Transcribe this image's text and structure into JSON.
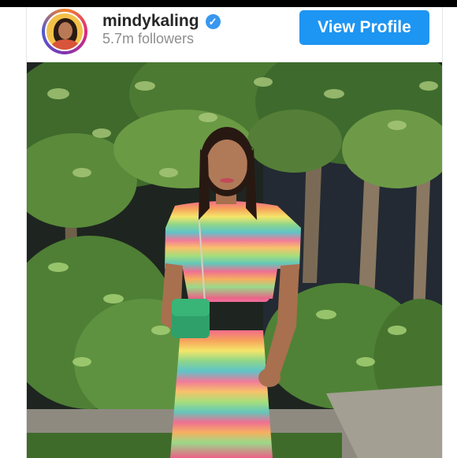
{
  "profile": {
    "username": "mindykaling",
    "followers": "5.7m followers",
    "view_profile_label": "View Profile",
    "verified_icon": "verified-badge-icon",
    "verified_color": "#3897f0"
  },
  "colors": {
    "button": "#1d95f2",
    "username": "#262626",
    "followers": "#8e8e8e"
  },
  "post": {
    "image": "photo of a woman in a rainbow-striped sequin top and skirt holding a green purse, standing in front of leafy trees"
  }
}
